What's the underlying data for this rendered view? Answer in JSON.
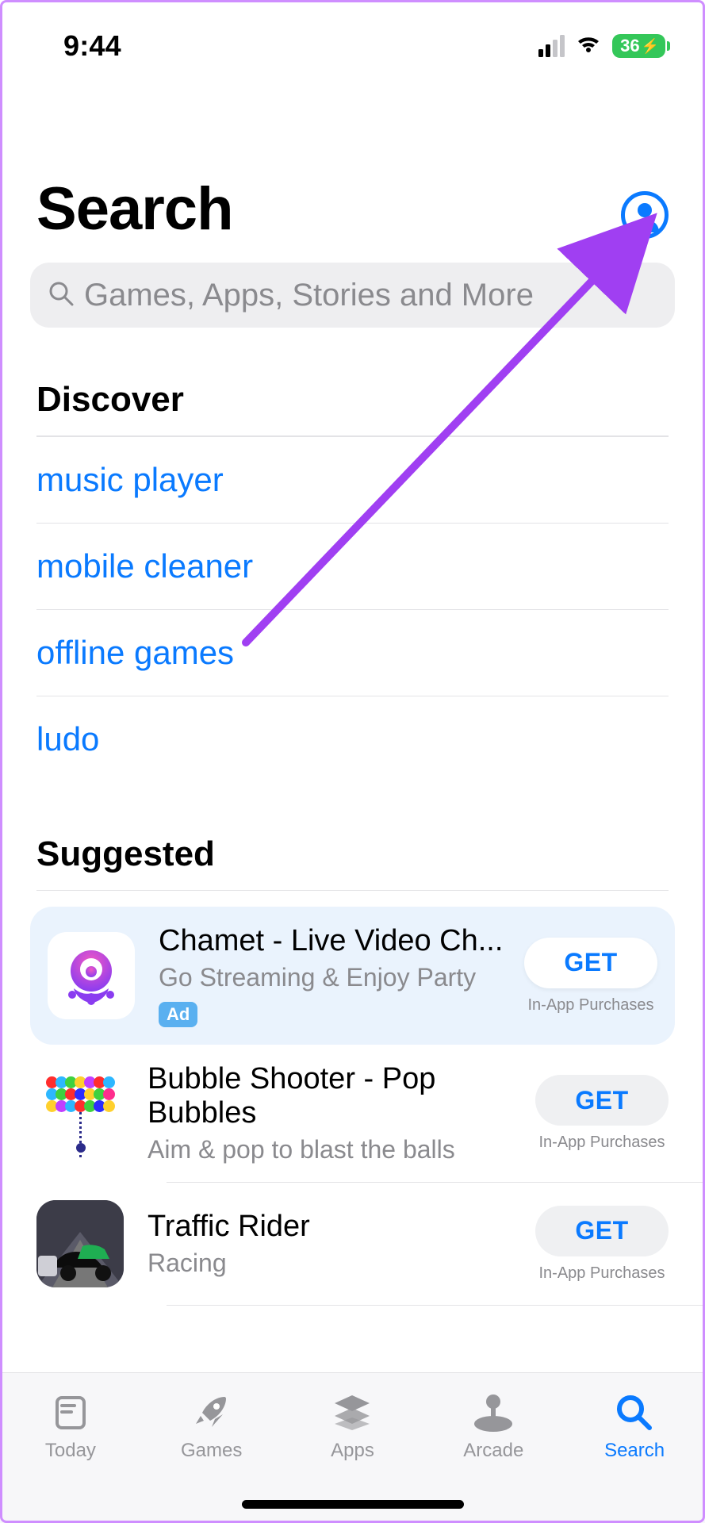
{
  "status": {
    "time": "9:44",
    "battery_percent": "36"
  },
  "header": {
    "title": "Search"
  },
  "search": {
    "placeholder": "Games, Apps, Stories and More"
  },
  "discover": {
    "heading": "Discover",
    "items": [
      "music player",
      "mobile cleaner",
      "offline games",
      "ludo"
    ]
  },
  "suggested": {
    "heading": "Suggested",
    "apps": [
      {
        "name": "Chamet - Live Video Ch...",
        "subtitle": "Go Streaming & Enjoy Party",
        "ad_label": "Ad",
        "action_label": "GET",
        "iap_label": "In-App Purchases",
        "promoted": true
      },
      {
        "name": "Bubble Shooter - Pop Bubbles",
        "subtitle": "Aim & pop to blast the balls",
        "action_label": "GET",
        "iap_label": "In-App Purchases",
        "promoted": false
      },
      {
        "name": "Traffic Rider",
        "subtitle": "Racing",
        "action_label": "GET",
        "iap_label": "In-App Purchases",
        "promoted": false
      }
    ]
  },
  "tabs": [
    {
      "label": "Today",
      "active": false
    },
    {
      "label": "Games",
      "active": false
    },
    {
      "label": "Apps",
      "active": false
    },
    {
      "label": "Arcade",
      "active": false
    },
    {
      "label": "Search",
      "active": true
    }
  ]
}
